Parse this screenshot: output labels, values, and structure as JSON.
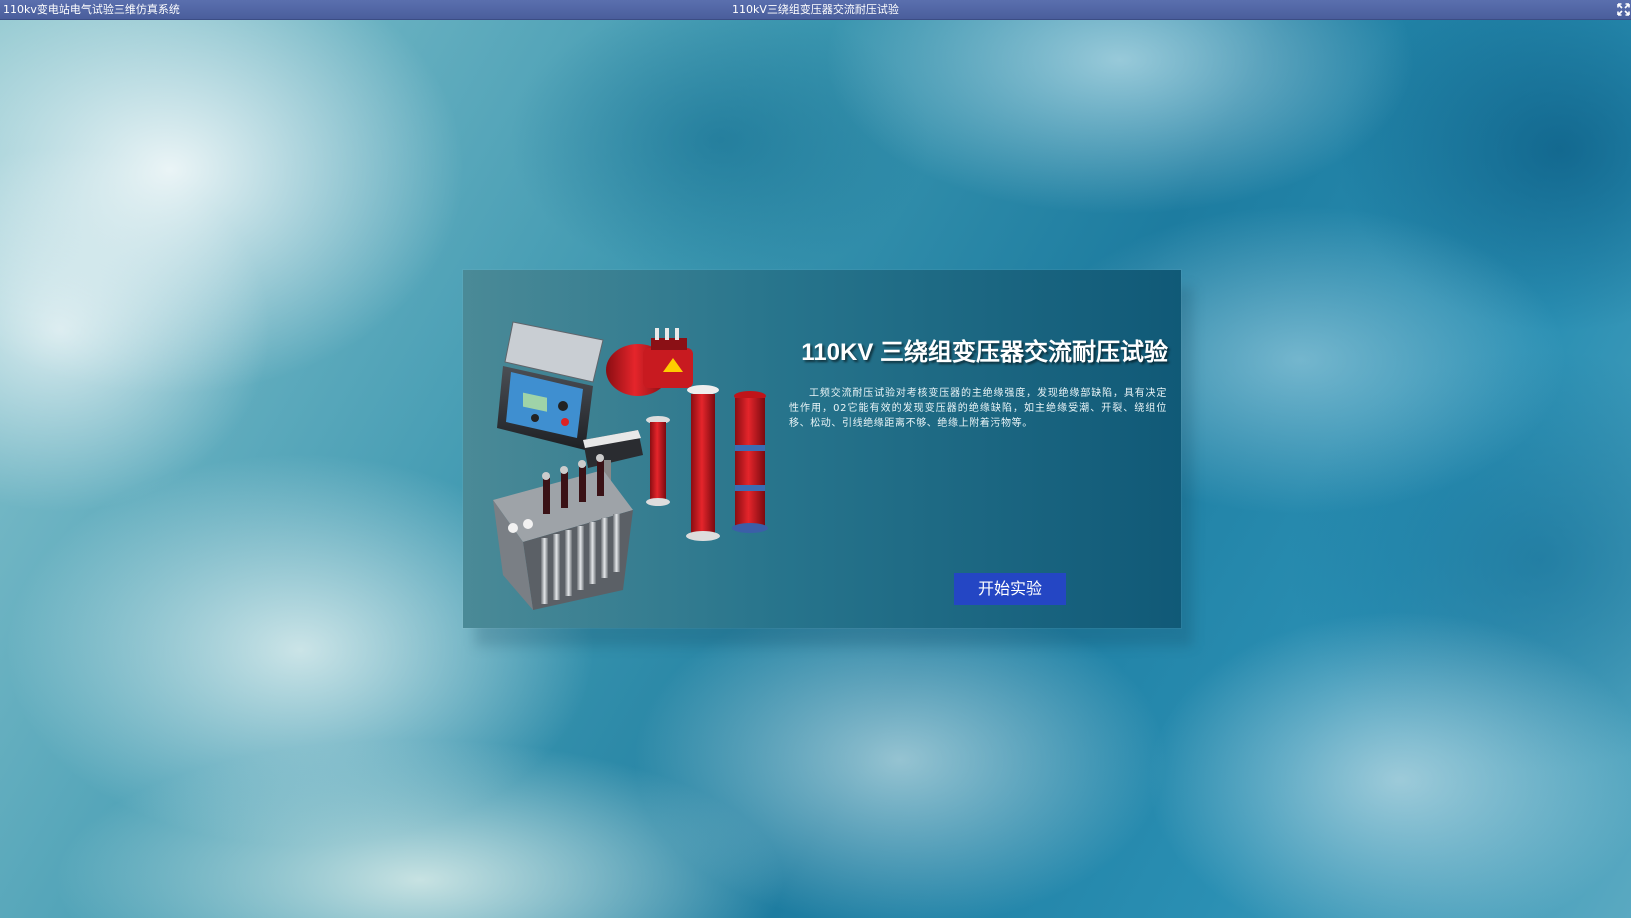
{
  "titlebar": {
    "app_title": "110kv变电站电气试验三维仿真系统",
    "window_title": "110kV三绕组变压器交流耐压试验",
    "fullscreen_icon": "fullscreen-icon"
  },
  "dialog": {
    "title": "110KV 三绕组变压器交流耐压试验",
    "description": "工频交流耐压试验对考核变压器的主绝缘强度，发现绝缘部缺陷，具有决定性作用，02它能有效的发现变压器的绝缘缺陷，如主绝缘受潮、开裂、绕组位移、松动、引线绝缘距离不够、绝缘上附着污物等。",
    "start_button": "开始实验",
    "equipment_image": "test-equipment-illustration"
  },
  "colors": {
    "titlebar": "#4f64a3",
    "button": "#2446c4",
    "title_text": "#ffffff"
  }
}
